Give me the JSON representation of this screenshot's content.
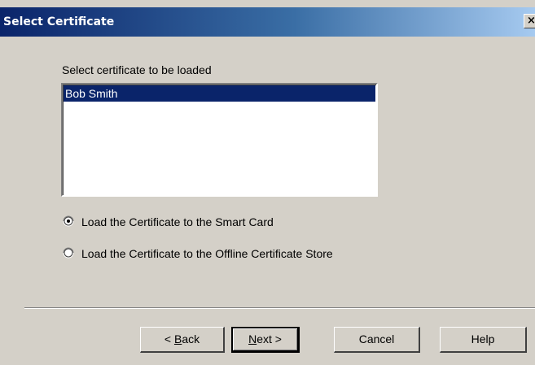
{
  "window": {
    "title": "Select Certificate",
    "close_glyph": "×"
  },
  "certificate_list": {
    "label": "Select certificate to be loaded",
    "items": [
      "Bob Smith"
    ],
    "selected": "Bob Smith"
  },
  "options": [
    {
      "label": "Load the Certificate to the Smart Card",
      "checked": true
    },
    {
      "label": "Load the Certificate to the Offline Certificate Store",
      "checked": false
    }
  ],
  "buttons": {
    "back": {
      "prefix": "< ",
      "mnemonic": "B",
      "rest": "ack"
    },
    "next": {
      "mnemonic": "N",
      "rest": "ext >"
    },
    "cancel": "Cancel",
    "help": "Help"
  },
  "colors": {
    "dialog_face": "#d4d0c8",
    "title_bar_start": "#0a246a",
    "title_bar_end": "#a6caf0",
    "selection": "#0a246a"
  }
}
